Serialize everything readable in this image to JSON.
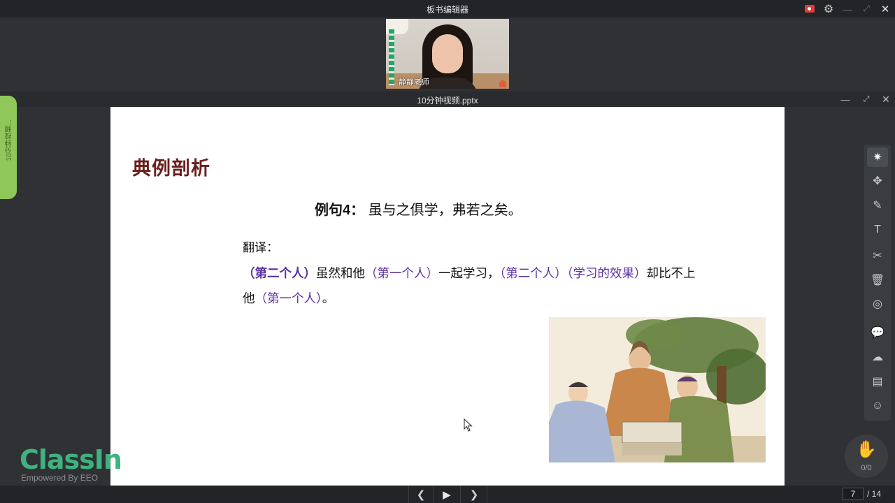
{
  "window": {
    "title": "板书编辑器"
  },
  "video": {
    "teacher_name": "静静老师"
  },
  "document": {
    "filename": "10分钟视频.pptx",
    "side_tab_label": "10分钟视频..."
  },
  "slide": {
    "heading": "典例剖析",
    "example_label": "例句4：",
    "example_sentence": "虽与之俱学，弗若之矣。",
    "translate_label": "翻译：",
    "translation": {
      "p1": "（第二个人）",
      "p2": "虽然和他",
      "p3": "（第一个人）",
      "p4": "一起学习，",
      "p5": "（第二个人）（学习的效果）",
      "p6": "却比不上他",
      "p7": "（第一个人）",
      "p8": "。"
    }
  },
  "hand_raise": {
    "count": "0/0"
  },
  "logo": {
    "brand": "ClassIn",
    "tagline": "Empowered By EEO"
  },
  "pager": {
    "current": "7",
    "total": "/ 14"
  },
  "colors": {
    "accent_green": "#3fb27f",
    "purple_text": "#5b2fa3",
    "heading": "#6a1f1c"
  }
}
